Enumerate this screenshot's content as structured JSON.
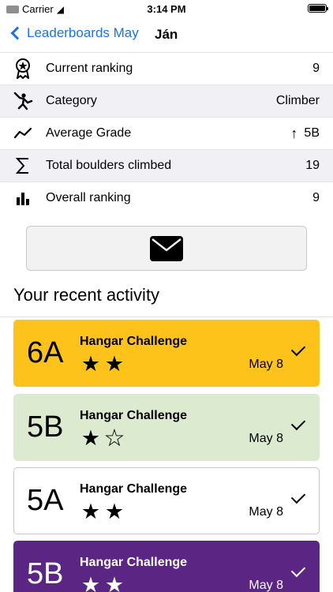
{
  "status_bar": {
    "carrier": "Carrier",
    "time": "3:14 PM"
  },
  "nav": {
    "back_label": "Leaderboards May",
    "title": "Ján"
  },
  "stats": [
    {
      "icon": "medal-icon",
      "label": "Current ranking",
      "value": "9"
    },
    {
      "icon": "climber-icon",
      "label": "Category",
      "value": "Climber"
    },
    {
      "icon": "trend-line-icon",
      "label": "Average Grade",
      "value": "5B",
      "trend": "up"
    },
    {
      "icon": "sigma-icon",
      "label": "Total boulders climbed",
      "value": "19"
    },
    {
      "icon": "bar-chart-icon",
      "label": "Overall ranking",
      "value": "9"
    }
  ],
  "mail_button": {
    "icon": "envelope-icon"
  },
  "section_title": "Your recent activity",
  "activities": [
    {
      "grade": "6A",
      "name": "Hangar Challenge",
      "stars": 2,
      "max_stars": 5,
      "date": "May 8",
      "completed": true,
      "bg": "#fdc31a",
      "text_color": "#000000"
    },
    {
      "grade": "5B",
      "name": "Hangar Challenge",
      "stars": 1.5,
      "max_stars": 5,
      "date": "May 8",
      "completed": true,
      "bg": "#dcebd0",
      "text_color": "#000000"
    },
    {
      "grade": "5A",
      "name": "Hangar Challenge",
      "stars": 2,
      "max_stars": 5,
      "date": "May 8",
      "completed": true,
      "bg": "#ffffff",
      "text_color": "#000000"
    },
    {
      "grade": "5B",
      "name": "Hangar Challenge",
      "stars": 2,
      "max_stars": 5,
      "date": "May 8",
      "completed": true,
      "bg": "#5b2583",
      "text_color": "#ffffff"
    }
  ]
}
